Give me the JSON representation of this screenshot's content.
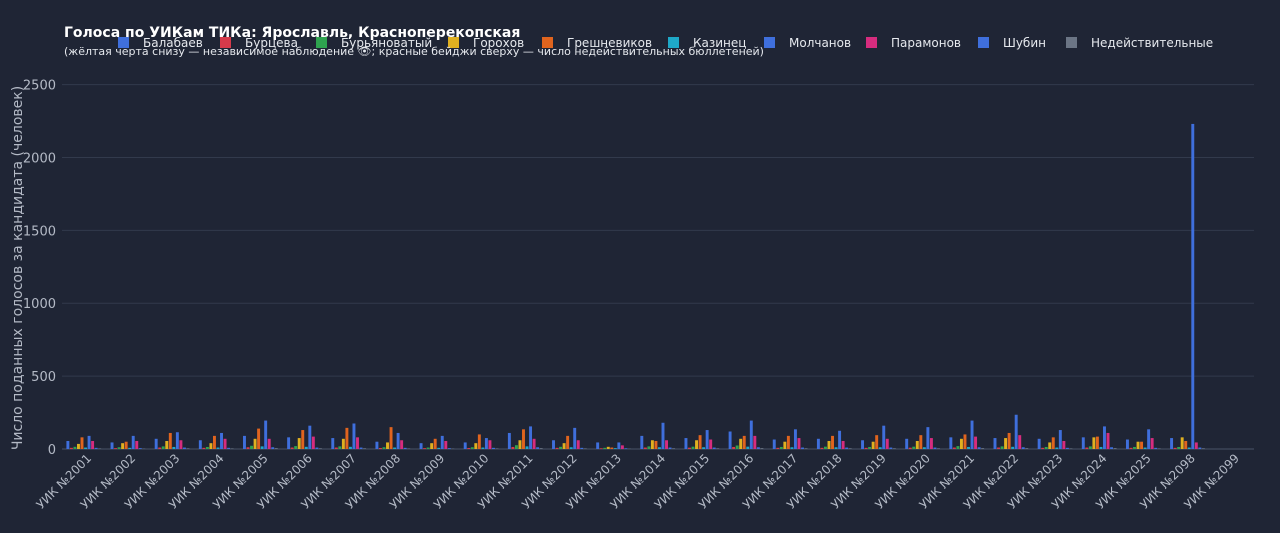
{
  "chart_data": {
    "type": "bar",
    "title": "Голоса по УИКам ТИКа: Ярославль, Красноперекопская",
    "subtitle": "(жёлтая черта снизу — независимое наблюдение 👁; красные бейджи сверху — число недействительных бюллетеней)",
    "ylabel": "Число поданных голосов за кандидата (человек)",
    "xlabel": "",
    "ylim": [
      0,
      2600
    ],
    "yticks": [
      0,
      500,
      1000,
      1500,
      2000,
      2500
    ],
    "grid": true,
    "legend_position": "top",
    "categories": [
      "УИК №2001",
      "УИК №2002",
      "УИК №2003",
      "УИК №2004",
      "УИК №2005",
      "УИК №2006",
      "УИК №2007",
      "УИК №2008",
      "УИК №2009",
      "УИК №2010",
      "УИК №2011",
      "УИК №2012",
      "УИК №2013",
      "УИК №2014",
      "УИК №2015",
      "УИК №2016",
      "УИК №2017",
      "УИК №2018",
      "УИК №2019",
      "УИК №2020",
      "УИК №2021",
      "УИК №2022",
      "УИК №2023",
      "УИК №2024",
      "УИК №2025",
      "УИК №2098",
      "УИК №2099"
    ],
    "series": [
      {
        "name": "Балабаев",
        "color": "#3f6fdc",
        "values": [
          55,
          45,
          70,
          60,
          90,
          80,
          75,
          50,
          40,
          45,
          110,
          60,
          45,
          90,
          75,
          120,
          65,
          70,
          60,
          70,
          80,
          75,
          70,
          80,
          65,
          75,
          0
        ]
      },
      {
        "name": "Бурцева",
        "color": "#d63a4a",
        "values": [
          8,
          6,
          10,
          8,
          12,
          10,
          10,
          7,
          6,
          7,
          14,
          8,
          5,
          10,
          9,
          14,
          8,
          8,
          8,
          9,
          10,
          10,
          8,
          10,
          8,
          8,
          0
        ]
      },
      {
        "name": "Бурьяноватый",
        "color": "#2ea34f",
        "values": [
          15,
          12,
          18,
          14,
          22,
          20,
          18,
          12,
          10,
          12,
          26,
          15,
          8,
          18,
          16,
          24,
          14,
          16,
          14,
          16,
          20,
          18,
          14,
          18,
          14,
          14,
          0
        ]
      },
      {
        "name": "Горохов",
        "color": "#e0b020",
        "values": [
          35,
          40,
          55,
          40,
          70,
          75,
          70,
          45,
          40,
          40,
          60,
          40,
          15,
          60,
          60,
          70,
          50,
          55,
          50,
          55,
          70,
          75,
          45,
          80,
          50,
          80,
          0
        ]
      },
      {
        "name": "Грешневиков",
        "color": "#e0641e",
        "values": [
          80,
          50,
          110,
          90,
          140,
          130,
          145,
          150,
          70,
          100,
          135,
          90,
          10,
          55,
          95,
          90,
          90,
          90,
          95,
          95,
          100,
          110,
          80,
          85,
          50,
          55,
          0
        ]
      },
      {
        "name": "Казинец",
        "color": "#1ea8c8",
        "values": [
          10,
          8,
          14,
          10,
          18,
          15,
          15,
          10,
          8,
          10,
          18,
          12,
          6,
          12,
          12,
          16,
          12,
          12,
          12,
          12,
          14,
          15,
          10,
          14,
          10,
          10,
          0
        ]
      },
      {
        "name": "Молчанов",
        "color": "#3f6fdc",
        "values": [
          90,
          90,
          115,
          110,
          195,
          160,
          175,
          110,
          90,
          75,
          155,
          145,
          45,
          180,
          130,
          195,
          135,
          125,
          160,
          150,
          195,
          235,
          130,
          155,
          135,
          2230,
          0
        ]
      },
      {
        "name": "Парамонов",
        "color": "#d62c7e",
        "values": [
          55,
          55,
          60,
          70,
          70,
          85,
          80,
          60,
          55,
          60,
          70,
          60,
          25,
          60,
          65,
          90,
          75,
          55,
          70,
          75,
          85,
          95,
          55,
          110,
          75,
          45,
          0
        ]
      },
      {
        "name": "Шубин",
        "color": "#3f6fdc",
        "values": [
          8,
          6,
          10,
          8,
          12,
          10,
          10,
          8,
          6,
          8,
          12,
          8,
          5,
          10,
          10,
          12,
          10,
          10,
          10,
          10,
          12,
          12,
          8,
          12,
          8,
          10,
          0
        ]
      },
      {
        "name": "Недействительные",
        "color": "#6b7585",
        "values": [
          4,
          3,
          5,
          4,
          6,
          5,
          5,
          4,
          3,
          4,
          6,
          4,
          2,
          5,
          5,
          6,
          5,
          5,
          5,
          5,
          6,
          6,
          4,
          6,
          4,
          5,
          0
        ]
      }
    ]
  }
}
